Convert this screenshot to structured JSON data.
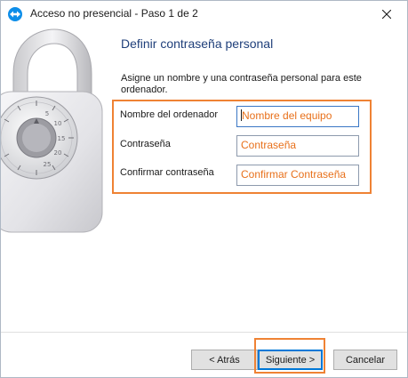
{
  "window": {
    "title": "Acceso no presencial - Paso 1 de 2"
  },
  "page": {
    "heading": "Definir contraseña personal",
    "instructions": "Asigne un nombre y una contraseña personal para este ordenador."
  },
  "form": {
    "computer_name": {
      "label": "Nombre del ordenador",
      "placeholder": "Nombre del equipo"
    },
    "password": {
      "label": "Contraseña",
      "placeholder": "Contraseña"
    },
    "confirm_password": {
      "label": "Confirmar contraseña",
      "placeholder": "Confirmar Contraseña"
    }
  },
  "buttons": {
    "back": "< Atrás",
    "next": "Siguiente >",
    "cancel": "Cancelar"
  },
  "icons": {
    "app": "teamviewer-icon",
    "close": "close-icon",
    "lock": "padlock-icon"
  },
  "colors": {
    "highlight": "#ef8234",
    "heading": "#1f3f7a",
    "field_text": "#e8701a",
    "default_button_border": "#0078d7"
  }
}
